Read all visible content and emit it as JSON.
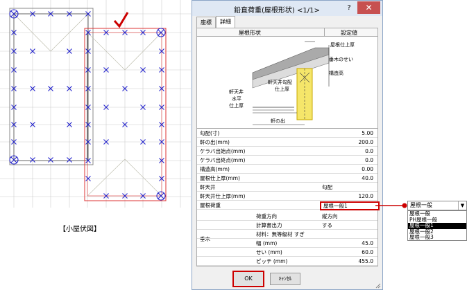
{
  "plan": {
    "caption": "【小屋伏図】"
  },
  "dialog": {
    "title": "鉛直荷重(屋根形状) <1/1>",
    "help": "?",
    "close": "✕",
    "tabs": [
      "座標",
      "詳細"
    ],
    "header": {
      "col1": "屋根形状",
      "col2": "設定値"
    },
    "diagram_labels": {
      "roof_thickness": "屋根仕上厚",
      "rafter_height": "垂木のせい",
      "structure_height": "構造高",
      "eave_ceiling_slope": "軒天井勾配",
      "finish_thickness": "仕上厚",
      "eave_ceiling": "軒天井",
      "horizontal": "水平",
      "finish_thickness2": "仕上厚",
      "eave_projection": "軒の出"
    },
    "rows": [
      {
        "label": "勾配(寸)",
        "value": "5.00"
      },
      {
        "label": "軒の出(mm)",
        "value": "200.0"
      },
      {
        "label": "ケラバ出始点(mm)",
        "value": "0.0"
      },
      {
        "label": "ケラバ出終点(mm)",
        "value": "0.0"
      },
      {
        "label": "構造高(mm)",
        "value": "0.00"
      },
      {
        "label": "屋根仕上厚(mm)",
        "value": "40.0"
      },
      {
        "label": "軒天井",
        "mid": "勾配"
      },
      {
        "label": "軒天井仕上厚(mm)",
        "value": "120.0"
      },
      {
        "label": "屋根荷重",
        "mid": "屋根一般1"
      }
    ],
    "truss_label": "垂木",
    "sub_rows": [
      {
        "label": "荷重方向",
        "mid": "縦方向"
      },
      {
        "label": "計算書出力",
        "mid": "する"
      },
      {
        "label": "材料：無等級材 すぎ",
        "mid": ""
      },
      {
        "label": "幅 (mm)",
        "value": "45.0"
      },
      {
        "label": "せい (mm)",
        "value": "60.0"
      },
      {
        "label": "ピッチ (mm)",
        "value": "455.0"
      }
    ],
    "ok": "OK",
    "cancel": "ｷｬﾝｾﾙ"
  },
  "dropdown": {
    "selected": "屋根一般",
    "options": [
      "屋根一般",
      "PH屋根一般",
      "屋根一般1",
      "屋根一般2",
      "屋根一般3"
    ],
    "highlighted_index": 2
  },
  "colors": {
    "accent": "#c00000",
    "marker": "#2222cc",
    "dialog_border": "#8aa4c6"
  }
}
